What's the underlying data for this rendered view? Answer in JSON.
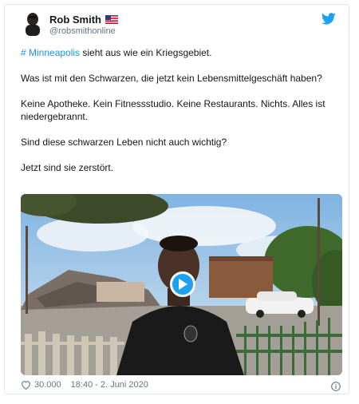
{
  "tweet": {
    "author_name": "Rob Smith",
    "handle": "@robsmithonline",
    "flag_icon": "us-flag-icon",
    "logo_icon": "twitter-bird-icon",
    "hashtag": "# Minneapolis",
    "line1_rest": " sieht aus wie ein Kriegsgebiet.",
    "line2": "Was ist mit den Schwarzen, die jetzt kein Lebensmittelgeschäft haben?",
    "line3": "Keine Apotheke. Kein Fitnessstudio. Keine Restaurants. Nichts. Alles ist niedergebrannt.",
    "line4": "Sind diese schwarzen Leben nicht auch wichtig?",
    "line5": "Jetzt sind sie zerstört.",
    "likes": "30.000",
    "timestamp": "18:40 - 2. Juni 2020",
    "colors": {
      "link": "#1b95e0",
      "brand": "#1da1f2",
      "muted": "#657786"
    }
  }
}
